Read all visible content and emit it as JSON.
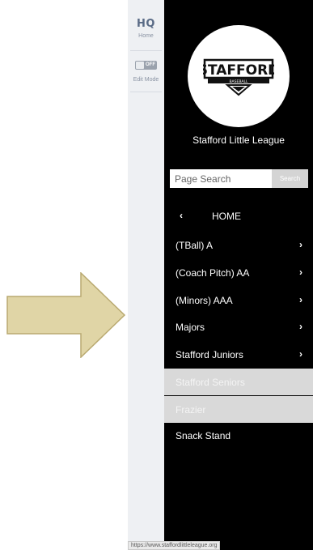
{
  "admin_bar": {
    "logo": "HQ",
    "home_label": "Home",
    "toggle_state": "OFF",
    "edit_mode_label": "Edit Mode"
  },
  "sidebar": {
    "logo_text": "STAFFORD",
    "logo_subtext": "BASEBALL",
    "org_name": "Stafford Little League",
    "search_placeholder": "Page Search",
    "search_button": "Search",
    "home_label": "HOME",
    "items": [
      {
        "label": "(TBall) A",
        "has_submenu": true
      },
      {
        "label": "(Coach Pitch) AA",
        "has_submenu": true
      },
      {
        "label": "(Minors) AAA",
        "has_submenu": true
      },
      {
        "label": "Majors",
        "has_submenu": true
      },
      {
        "label": "Stafford Juniors",
        "has_submenu": true
      },
      {
        "label": "Stafford Seniors",
        "has_submenu": false
      },
      {
        "label": "Frazier",
        "has_submenu": false
      },
      {
        "label": "Snack Stand",
        "has_submenu": false
      }
    ]
  },
  "status_url": "https://www.staffordlittleleague.org",
  "colors": {
    "sidebar_bg": "#000000",
    "admin_bg": "#eef0f3",
    "arrow_fill": "#e0d5a6",
    "arrow_stroke": "#b9a970",
    "disabled_item_bg": "#d9d9d9"
  }
}
